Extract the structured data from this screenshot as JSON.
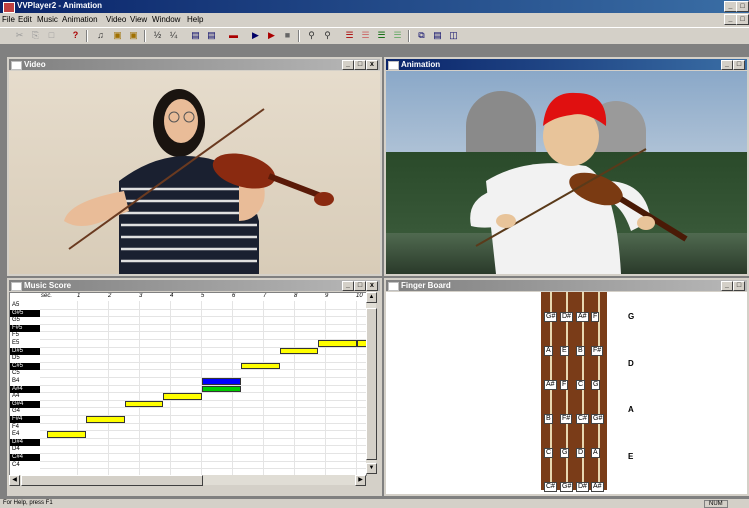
{
  "app": {
    "title": "VVPlayer2 - Animation"
  },
  "menu": [
    "File",
    "Edit",
    "Music",
    "Animation",
    "Video",
    "View",
    "Window",
    "Help"
  ],
  "window_buttons": {
    "minimize": "_",
    "restore": "̱",
    "close": "x"
  },
  "toolbar": {
    "icons": [
      "cut-icon",
      "copy-icon",
      "paste-icon",
      "help-icon",
      "tempo-icon",
      "open-icon",
      "save-icon",
      "half-speed-icon",
      "quarter-speed-icon",
      "record-icon",
      "export-icon",
      "stop-icon",
      "play-icon",
      "play-2-icon",
      "pause-icon",
      "zoom-in-icon",
      "zoom-out-icon",
      "layout-1-icon",
      "layout-2-icon",
      "layout-3-icon",
      "layout-4-icon",
      "cascade-icon",
      "tile-h-icon",
      "tile-v-icon"
    ]
  },
  "windows": {
    "video": {
      "title": "Video"
    },
    "animation": {
      "title": "Animation"
    },
    "score": {
      "title": "Music Score"
    },
    "fingerboard": {
      "title": "Finger Board"
    }
  },
  "score": {
    "header_label": "sec.",
    "measures": [
      "1",
      "2",
      "3",
      "4",
      "5",
      "6",
      "7",
      "8",
      "9",
      "10"
    ],
    "notes": [
      "A5",
      "G#5",
      "G5",
      "F#5",
      "F5",
      "E5",
      "D#5",
      "D5",
      "C#5",
      "C5",
      "B4",
      "A#4",
      "A4",
      "G#4",
      "G4",
      "F#4",
      "F4",
      "E4",
      "D#4",
      "D4",
      "C#4",
      "C4"
    ],
    "sharps": [
      "G#5",
      "F#5",
      "D#5",
      "C#5",
      "A#4",
      "G#4",
      "F#4",
      "D#4",
      "C#4"
    ],
    "bars": [
      {
        "note": "E4",
        "start": 0,
        "len": 1.25,
        "color": "#ffff00"
      },
      {
        "note": "F#4",
        "start": 1.25,
        "len": 1.25,
        "color": "#ffff00"
      },
      {
        "note": "G#4",
        "start": 2.5,
        "len": 1.25,
        "color": "#ffff00"
      },
      {
        "note": "A4",
        "start": 3.75,
        "len": 1.25,
        "color": "#ffff00"
      },
      {
        "note": "B4",
        "start": 5,
        "len": 1.25,
        "color": "#0000ff"
      },
      {
        "note": "A#4",
        "start": 5,
        "len": 1.25,
        "color": "#00cc00"
      },
      {
        "note": "C#5",
        "start": 6.25,
        "len": 1.25,
        "color": "#ffff00"
      },
      {
        "note": "D#5",
        "start": 7.5,
        "len": 1.25,
        "color": "#ffff00"
      },
      {
        "note": "E5",
        "start": 8.75,
        "len": 1.25,
        "color": "#ffff00"
      },
      {
        "note": "E5",
        "start": 10,
        "len": 0.7,
        "color": "#ffff00"
      }
    ]
  },
  "fingerboard": {
    "strings": [
      "G",
      "D",
      "A",
      "E"
    ],
    "rows": [
      [
        "G#",
        "D#",
        "A#",
        "F"
      ],
      [
        "A",
        "E",
        "B",
        "F#"
      ],
      [
        "A#",
        "F",
        "C",
        "G"
      ],
      [
        "B",
        "F#",
        "C#",
        "G#"
      ],
      [
        "C",
        "G",
        "D",
        "A"
      ],
      [
        "C#",
        "G#",
        "D#",
        "A#"
      ]
    ]
  },
  "status": {
    "text": "For Help, press F1",
    "indicator": "NUM"
  }
}
